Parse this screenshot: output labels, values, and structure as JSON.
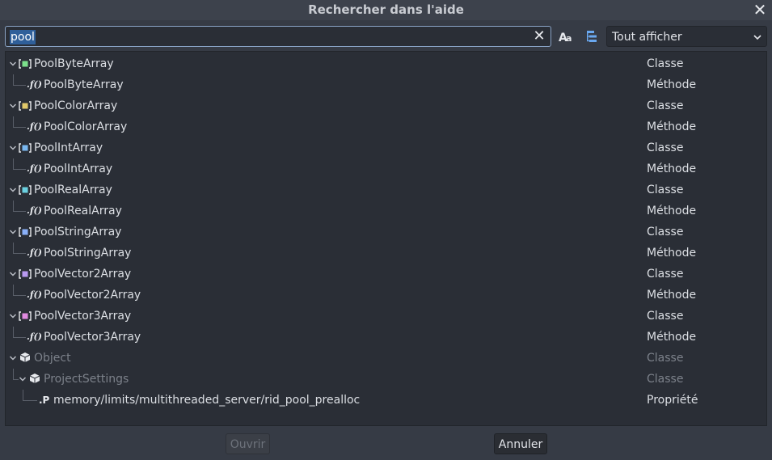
{
  "window": {
    "title": "Rechercher dans l'aide"
  },
  "search": {
    "value": "pool"
  },
  "filter": {
    "selected": "Tout afficher"
  },
  "results": [
    {
      "name": "PoolByteArray",
      "type": "Classe",
      "kind": "class",
      "icon_color": "#7ce08c"
    },
    {
      "name": "PoolByteArray",
      "type": "Méthode",
      "kind": "method"
    },
    {
      "name": "PoolColorArray",
      "type": "Classe",
      "kind": "class",
      "icon_color": "#e0c86a"
    },
    {
      "name": "PoolColorArray",
      "type": "Méthode",
      "kind": "method"
    },
    {
      "name": "PoolIntArray",
      "type": "Classe",
      "kind": "class",
      "icon_color": "#7ab8f0"
    },
    {
      "name": "PoolIntArray",
      "type": "Méthode",
      "kind": "method"
    },
    {
      "name": "PoolRealArray",
      "type": "Classe",
      "kind": "class",
      "icon_color": "#6ad0e0"
    },
    {
      "name": "PoolRealArray",
      "type": "Méthode",
      "kind": "method"
    },
    {
      "name": "PoolStringArray",
      "type": "Classe",
      "kind": "class",
      "icon_color": "#8ab0f8"
    },
    {
      "name": "PoolStringArray",
      "type": "Méthode",
      "kind": "method"
    },
    {
      "name": "PoolVector2Array",
      "type": "Classe",
      "kind": "class",
      "icon_color": "#b89af0"
    },
    {
      "name": "PoolVector2Array",
      "type": "Méthode",
      "kind": "method"
    },
    {
      "name": "PoolVector3Array",
      "type": "Classe",
      "kind": "class",
      "icon_color": "#e08ae0"
    },
    {
      "name": "PoolVector3Array",
      "type": "Méthode",
      "kind": "method"
    },
    {
      "name": "Object",
      "type": "Classe",
      "kind": "object",
      "dim": true
    },
    {
      "name": "ProjectSettings",
      "type": "Classe",
      "kind": "object2",
      "dim": true
    },
    {
      "name": "memory/limits/multithreaded_server/rid_pool_prealloc",
      "type": "Propriété",
      "kind": "property"
    }
  ],
  "buttons": {
    "open": "Ouvrir",
    "cancel": "Annuler"
  },
  "icons": {
    "close": "close-icon",
    "clear": "clear-icon",
    "case": "case-sensitive-icon",
    "hierarchy": "hierarchy-icon",
    "chevron": "chevron-down-icon",
    "class": "class-icon",
    "method": "method-icon",
    "property": "property-icon",
    "node": "node-icon"
  }
}
